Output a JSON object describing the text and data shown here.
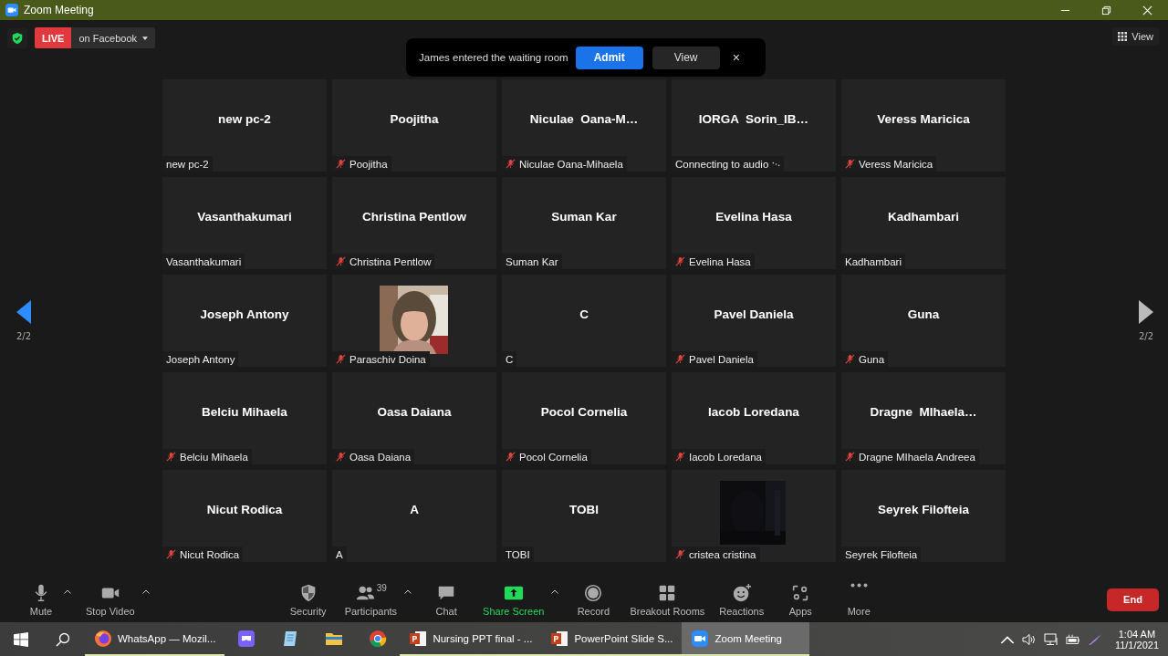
{
  "window": {
    "title": "Zoom Meeting"
  },
  "live": {
    "badge": "LIVE",
    "target": "on Facebook"
  },
  "notification": {
    "text": "James entered the waiting room",
    "admit": "Admit",
    "view": "View",
    "close": "×"
  },
  "view_button": {
    "label": "View"
  },
  "pager": {
    "left": "2/2",
    "right": "2/2"
  },
  "tiles": [
    {
      "kind": "name",
      "title": "new pc-2",
      "label": "new pc-2",
      "muted": false,
      "connecting": false
    },
    {
      "kind": "name",
      "title": "Poojitha",
      "label": "Poojitha",
      "muted": true,
      "connecting": false
    },
    {
      "kind": "name",
      "title": "Niculae  Oana-M…",
      "label": "Niculae Oana-Mihaela",
      "muted": true,
      "connecting": false
    },
    {
      "kind": "name",
      "title": "IORGA  Sorin_IB…",
      "label": "Connecting to audio",
      "muted": false,
      "connecting": true
    },
    {
      "kind": "name",
      "title": "Veress Maricica",
      "label": "Veress Maricica",
      "muted": true,
      "connecting": false
    },
    {
      "kind": "name",
      "title": "Vasanthakumari",
      "label": "Vasanthakumari",
      "muted": false,
      "connecting": false
    },
    {
      "kind": "name",
      "title": "Christina Pentlow",
      "label": "Christina Pentlow",
      "muted": true,
      "connecting": false
    },
    {
      "kind": "name",
      "title": "Suman Kar",
      "label": "Suman Kar",
      "muted": false,
      "connecting": false
    },
    {
      "kind": "name",
      "title": "Evelina Hasa",
      "label": "Evelina Hasa",
      "muted": true,
      "connecting": false
    },
    {
      "kind": "name",
      "title": "Kadhambari",
      "label": "Kadhambari",
      "muted": false,
      "connecting": false
    },
    {
      "kind": "name",
      "title": "Joseph Antony",
      "label": "Joseph Antony",
      "muted": false,
      "connecting": false
    },
    {
      "label": "Paraschiv Doina",
      "muted": true,
      "connecting": false
    },
    {
      "kind": "name",
      "title": "C",
      "label": "C",
      "muted": false,
      "connecting": false
    },
    {
      "kind": "name",
      "title": "Pavel Daniela",
      "label": "Pavel Daniela",
      "muted": true,
      "connecting": false
    },
    {
      "kind": "name",
      "title": "Guna",
      "label": "Guna",
      "muted": true,
      "connecting": false
    },
    {
      "kind": "name",
      "title": "Belciu Mihaela",
      "label": "Belciu Mihaela",
      "muted": true,
      "connecting": false
    },
    {
      "kind": "name",
      "title": "Oasa Daiana",
      "label": "Oasa Daiana",
      "muted": true,
      "connecting": false
    },
    {
      "kind": "name",
      "title": "Pocol Cornelia",
      "label": "Pocol Cornelia",
      "muted": true,
      "connecting": false
    },
    {
      "kind": "name",
      "title": "Iacob Loredana",
      "label": "Iacob Loredana",
      "muted": true,
      "connecting": false
    },
    {
      "kind": "name",
      "title": "Dragne  MIhaela…",
      "label": "Dragne MIhaela Andreea",
      "muted": true,
      "connecting": false
    },
    {
      "kind": "name",
      "title": "Nicut Rodica",
      "label": "Nicut Rodica",
      "muted": true,
      "connecting": false
    },
    {
      "kind": "name",
      "title": "A",
      "label": "A",
      "muted": false,
      "connecting": false
    },
    {
      "kind": "name",
      "title": "TOBI",
      "label": "TOBI",
      "muted": false,
      "connecting": false
    },
    {
      "kind": "video",
      "label": "cristea cristina",
      "muted": true,
      "connecting": false
    },
    {
      "kind": "name",
      "title": "Seyrek Filofteia",
      "label": "Seyrek Filofteia",
      "muted": false,
      "connecting": false
    }
  ],
  "toolbar": {
    "left": [
      {
        "label": "Mute",
        "caret": true
      },
      {
        "label": "Stop Video",
        "caret": true
      }
    ],
    "center": [
      {
        "label": "Security",
        "caret": false
      },
      {
        "label": "Participants",
        "count": "39",
        "caret": true
      },
      {
        "label": "Chat",
        "caret": false
      },
      {
        "label": "Share Screen",
        "caret": true
      },
      {
        "label": "Record",
        "caret": false
      },
      {
        "label": "Breakout Rooms",
        "caret": false
      },
      {
        "label": "Reactions",
        "caret": false
      },
      {
        "label": "Apps",
        "caret": false
      },
      {
        "label": "More",
        "caret": false
      }
    ],
    "end": "End"
  },
  "taskbar": {
    "apps": [
      {
        "kind": "labeled",
        "label": "WhatsApp — Mozil...",
        "running": true,
        "selected": false
      },
      {
        "kind": "icon",
        "running": false,
        "selected": false
      },
      {
        "kind": "icon",
        "running": false,
        "selected": false
      },
      {
        "kind": "icon",
        "running": false,
        "selected": false
      },
      {
        "kind": "icon",
        "running": false,
        "selected": false
      },
      {
        "kind": "labeled",
        "label": "Nursing PPT final - ...",
        "running": true,
        "selected": false
      },
      {
        "kind": "labeled",
        "label": "PowerPoint Slide S...",
        "running": true,
        "selected": false
      },
      {
        "kind": "labeled",
        "label": "Zoom Meeting",
        "running": true,
        "selected": true
      }
    ],
    "time": "1:04 AM",
    "date": "11/1/2021"
  }
}
